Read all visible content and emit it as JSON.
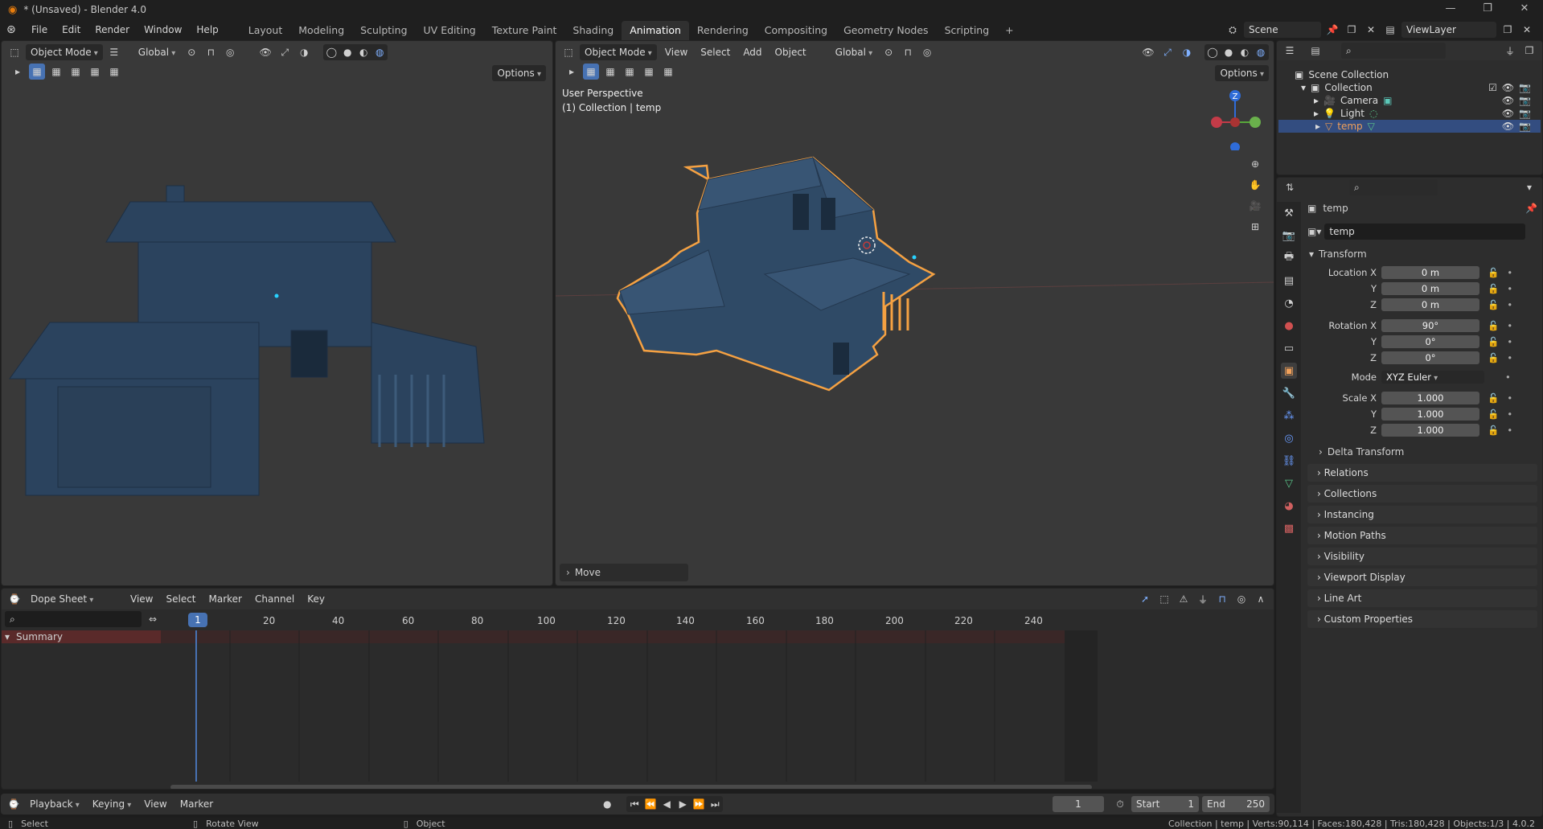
{
  "window": {
    "title": "* (Unsaved) - Blender 4.0",
    "controls": [
      "—",
      "❐",
      "✕"
    ]
  },
  "menu": [
    "File",
    "Edit",
    "Render",
    "Window",
    "Help"
  ],
  "workspaces": [
    "Layout",
    "Modeling",
    "Sculpting",
    "UV Editing",
    "Texture Paint",
    "Shading",
    "Animation",
    "Rendering",
    "Compositing",
    "Geometry Nodes",
    "Scripting"
  ],
  "active_workspace": "Animation",
  "scene": {
    "name": "Scene",
    "view_layer": "ViewLayer"
  },
  "left_viewport": {
    "mode": "Object Mode",
    "orientation": "Global",
    "options": "Options"
  },
  "right_viewport": {
    "mode": "Object Mode",
    "menus": [
      "View",
      "Select",
      "Add",
      "Object"
    ],
    "orientation": "Global",
    "options": "Options",
    "perspective": "User Perspective",
    "collection_info": "(1) Collection | temp",
    "last_op": "Move"
  },
  "gizmo": {
    "z": "Z"
  },
  "outliner": {
    "scene_collection": "Scene Collection",
    "collection": "Collection",
    "items": [
      "Camera",
      "Light",
      "temp"
    ]
  },
  "properties": {
    "object_name": "temp",
    "data_name": "temp",
    "transform_label": "Transform",
    "location_label": "Location X",
    "rotation_label": "Rotation X",
    "mode_label": "Mode",
    "scale_label": "Scale X",
    "axis_y": "Y",
    "axis_z": "Z",
    "location": [
      "0 m",
      "0 m",
      "0 m"
    ],
    "rotation": [
      "90°",
      "0°",
      "0°"
    ],
    "mode": "XYZ Euler",
    "scale": [
      "1.000",
      "1.000",
      "1.000"
    ],
    "delta": "Delta Transform",
    "panels": [
      "Relations",
      "Collections",
      "Instancing",
      "Motion Paths",
      "Visibility",
      "Viewport Display",
      "Line Art",
      "Custom Properties"
    ]
  },
  "dopesheet": {
    "mode": "Dope Sheet",
    "menus": [
      "View",
      "Select",
      "Marker",
      "Channel",
      "Key"
    ],
    "summary": "Summary",
    "current_frame": "1",
    "ticks": [
      "20",
      "40",
      "60",
      "80",
      "100",
      "120",
      "140",
      "160",
      "180",
      "200",
      "220",
      "240"
    ]
  },
  "timeline": {
    "menus": [
      "Playback",
      "Keying",
      "View",
      "Marker"
    ],
    "frame": "1",
    "start_label": "Start",
    "start": "1",
    "end_label": "End",
    "end": "250"
  },
  "status": {
    "select": "Select",
    "rotate": "Rotate View",
    "object": "Object",
    "stats": "Collection | temp | Verts:90,114 | Faces:180,428 | Tris:180,428 | Objects:1/3 | 4.0.2"
  },
  "colors": {
    "accent": "#4772b3",
    "selection_outline": "#f5a142",
    "house": "#2f4a66",
    "summary": "#5a2a2a"
  }
}
